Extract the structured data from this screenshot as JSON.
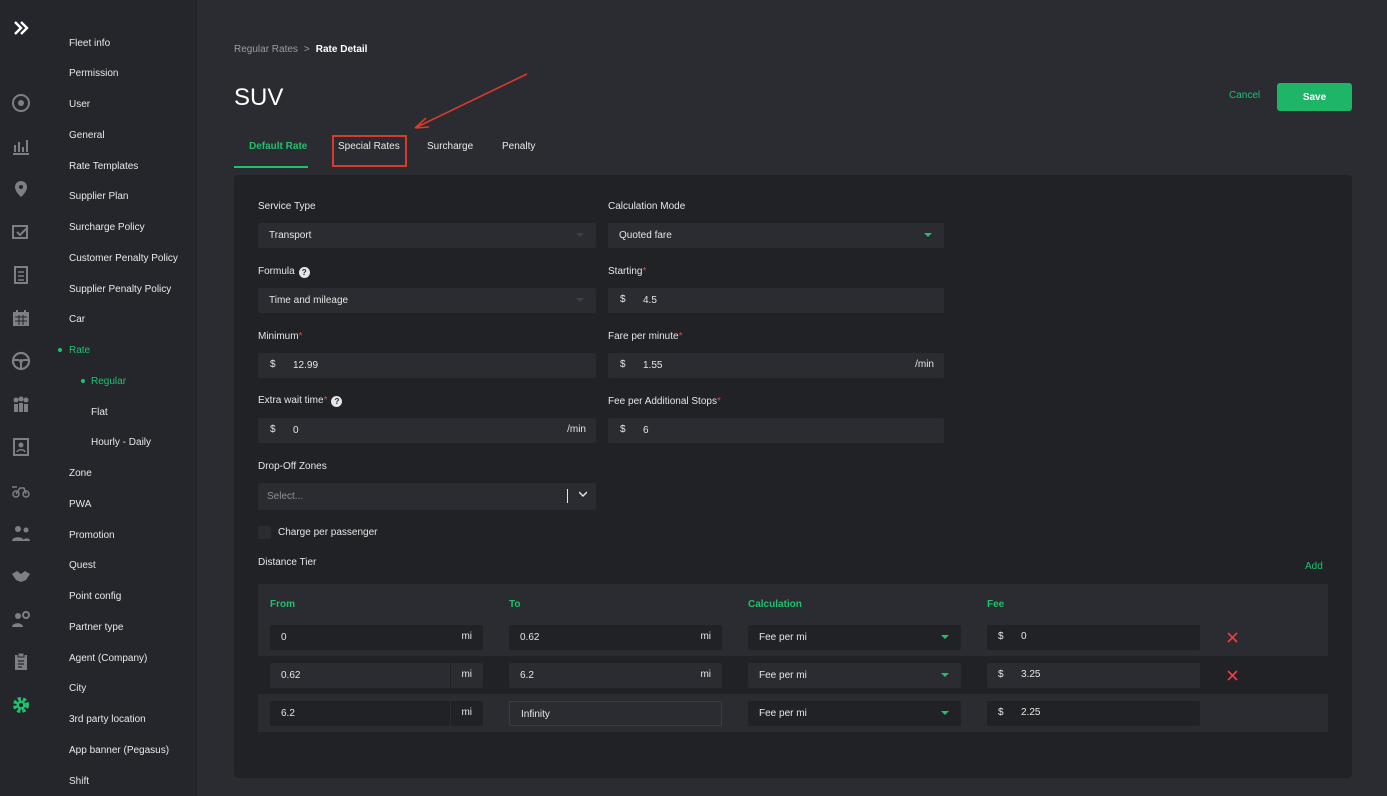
{
  "rail": {
    "toggle_icon": "double-chevron-right-icon",
    "icons": [
      "dashboard-icon",
      "analytics-icon",
      "map-pin-icon",
      "checklist-icon",
      "report-icon",
      "calendar-icon",
      "steering-wheel-icon",
      "group-icon",
      "id-card-icon",
      "delivery-icon",
      "team-icon",
      "handshake-icon",
      "user-settings-icon",
      "clipboard-icon",
      "settings-icon"
    ]
  },
  "menu": {
    "items": [
      {
        "label": "Fleet info"
      },
      {
        "label": "Permission"
      },
      {
        "label": "User"
      },
      {
        "label": "General"
      },
      {
        "label": "Rate Templates"
      },
      {
        "label": "Supplier Plan"
      },
      {
        "label": "Surcharge Policy"
      },
      {
        "label": "Customer Penalty Policy"
      },
      {
        "label": "Supplier Penalty Policy"
      },
      {
        "label": "Car"
      },
      {
        "label": "Rate"
      },
      {
        "label": "Regular"
      },
      {
        "label": "Flat"
      },
      {
        "label": "Hourly - Daily"
      },
      {
        "label": "Zone"
      },
      {
        "label": "PWA"
      },
      {
        "label": "Promotion"
      },
      {
        "label": "Quest"
      },
      {
        "label": "Point config"
      },
      {
        "label": "Partner type"
      },
      {
        "label": "Agent (Company)"
      },
      {
        "label": "City"
      },
      {
        "label": "3rd party location"
      },
      {
        "label": "App banner (Pegasus)"
      },
      {
        "label": "Shift"
      }
    ]
  },
  "breadcrumb": {
    "parent": "Regular Rates",
    "separator": ">",
    "current": "Rate Detail"
  },
  "page": {
    "title": "SUV",
    "cancel_label": "Cancel",
    "save_label": "Save"
  },
  "tabs": [
    {
      "label": "Default Rate"
    },
    {
      "label": "Special Rates"
    },
    {
      "label": "Surcharge"
    },
    {
      "label": "Penalty"
    }
  ],
  "form": {
    "service_type": {
      "label": "Service Type",
      "value": "Transport"
    },
    "calculation_mode": {
      "label": "Calculation Mode",
      "value": "Quoted fare"
    },
    "formula": {
      "label": "Formula",
      "value": "Time and mileage"
    },
    "starting": {
      "label": "Starting",
      "currency": "$",
      "value": "4.5"
    },
    "minimum": {
      "label": "Minimum",
      "currency": "$",
      "value": "12.99"
    },
    "fare_per_minute": {
      "label": "Fare per minute",
      "currency": "$",
      "value": "1.55",
      "unit": "/min"
    },
    "extra_wait_time": {
      "label": "Extra wait time",
      "currency": "$",
      "value": "0",
      "unit": "/min"
    },
    "fee_additional_stops": {
      "label": "Fee per Additional Stops",
      "currency": "$",
      "value": "6"
    },
    "dropoff_zones": {
      "label": "Drop-Off Zones",
      "placeholder": "Select..."
    },
    "charge_per_passenger": {
      "label": "Charge per passenger",
      "checked": false
    },
    "required_mark": "*",
    "help_glyph": "?"
  },
  "distance_tier": {
    "label": "Distance Tier",
    "add_label": "Add",
    "columns": [
      "From",
      "To",
      "Calculation",
      "Fee"
    ],
    "rows": [
      {
        "from": "0",
        "from_unit": "mi",
        "to": "0.62",
        "to_unit": "mi",
        "calc": "Fee per mi",
        "currency": "$",
        "fee": "0",
        "deletable": true
      },
      {
        "from": "0.62",
        "from_unit": "mi",
        "to": "6.2",
        "to_unit": "mi",
        "calc": "Fee per mi",
        "currency": "$",
        "fee": "3.25",
        "deletable": true
      },
      {
        "from": "6.2",
        "from_unit": "mi",
        "to": "Infinity",
        "to_unit": "",
        "calc": "Fee per mi",
        "currency": "$",
        "fee": "2.25",
        "deletable": false
      }
    ]
  },
  "colors": {
    "accent": "#1fc16b",
    "danger": "#e0454b",
    "annotation": "#d93a2b"
  }
}
